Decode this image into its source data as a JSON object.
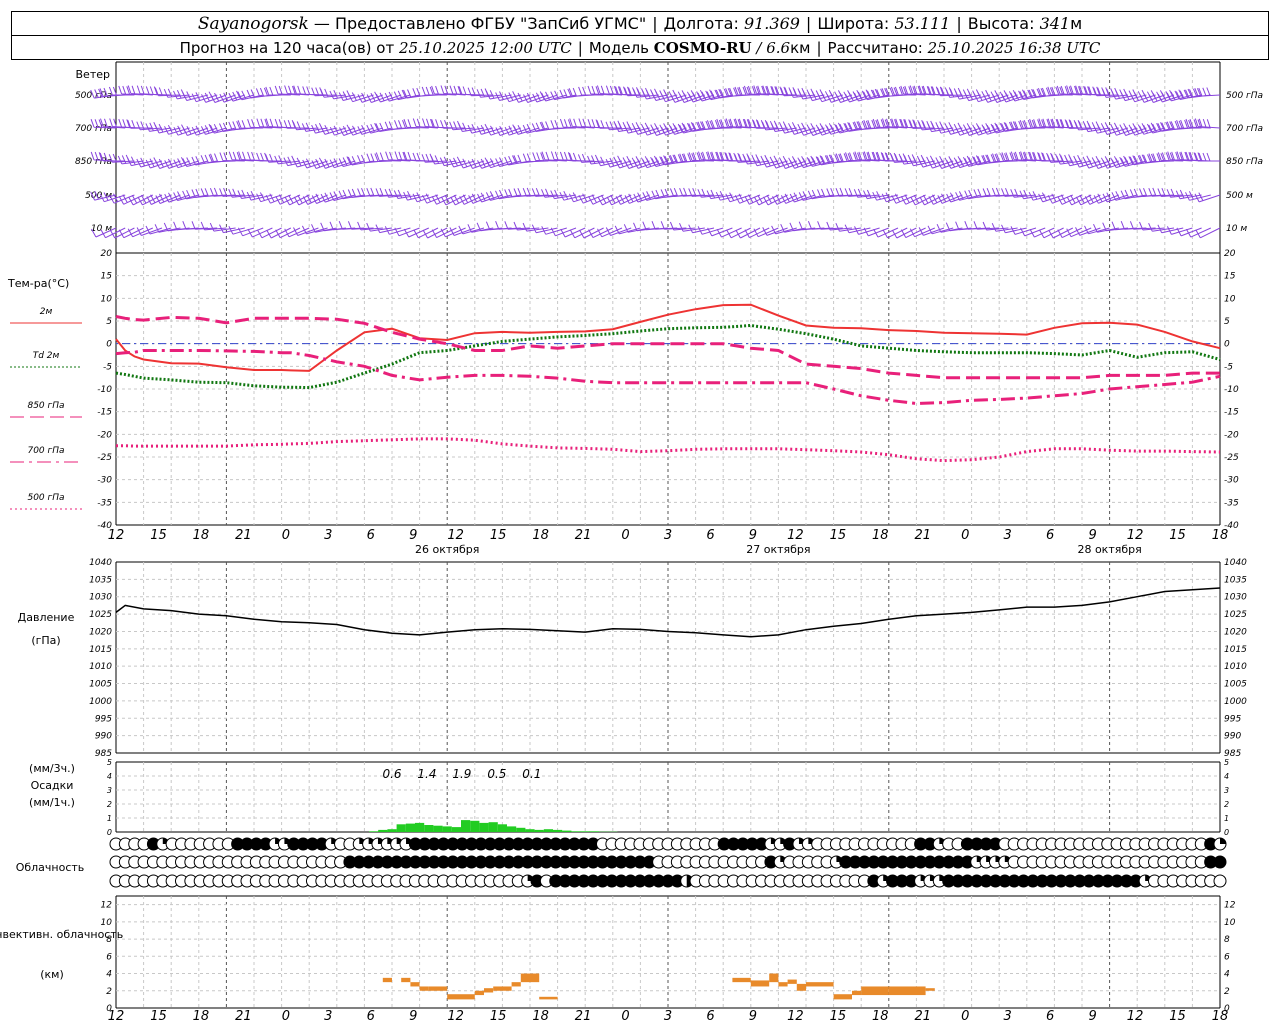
{
  "header": {
    "station": "Sayanogorsk",
    "provider": "— Предоставлено ФГБУ \"ЗапСиб УГМС\"",
    "lon_label": "Долгота:",
    "lon_value": "91.369",
    "lat_label": "Широта:",
    "lat_value": "53.111",
    "alt_label": "Высота:",
    "alt_value": "341",
    "alt_unit": "м",
    "forecast_label": "Прогноз на 120 часа(ов) от",
    "forecast_start": "25.10.2025 12:00 UTC",
    "model_label": "Модель",
    "model_name": "COSMO-RU",
    "model_res": "/ 6.6",
    "model_res_unit": "км",
    "calc_label": "Рассчитано:",
    "calc_time": "25.10.2025 16:38 UTC"
  },
  "colors": {
    "t2m": "#ee3333",
    "td2m": "#117711",
    "t850": "#e8207a",
    "t700": "#e8207a",
    "t500": "#e8207a",
    "wind": "#8844dd",
    "precip": "#22cc22",
    "conv": "#e88a2a",
    "pressure": "#000000"
  },
  "chart_data": [
    {
      "type": "wind-barbs",
      "title": "Ветер",
      "levels": [
        "500 гПа",
        "700 гПа",
        "850 гПа",
        "500 м",
        "10 м"
      ],
      "note": "wind barbs at 5 levels, hourly, mostly westerly/north-westerly flow"
    },
    {
      "type": "line",
      "title": "Тем-ра(°С)",
      "ylim": [
        -40,
        20
      ],
      "yticks": [
        20,
        15,
        10,
        5,
        0,
        -5,
        -10,
        -15,
        -20,
        -25,
        -30,
        -35,
        -40
      ],
      "x_hours_from_start": [
        0,
        1,
        2,
        3,
        6,
        9,
        12,
        15,
        18,
        19,
        21,
        24,
        27,
        30,
        33,
        36,
        39,
        42,
        45,
        48,
        51,
        54,
        57,
        60,
        63,
        66,
        69,
        72,
        75,
        78,
        81,
        84,
        87,
        90,
        93,
        96,
        99,
        102,
        105,
        108,
        111,
        114,
        117,
        120
      ],
      "series": [
        {
          "name": "2м",
          "style": "solid",
          "values": [
            1,
            -1.5,
            -2.8,
            -3.5,
            -4.3,
            -4.4,
            -5.2,
            -5.8,
            -5.8,
            -5.9,
            -6,
            -1.5,
            2.5,
            3.3,
            1.2,
            0.8,
            2.3,
            2.6,
            2.4,
            2.6,
            2.7,
            3.2,
            4.8,
            6.4,
            7.6,
            8.5,
            8.6,
            6.2,
            4,
            3.5,
            3.4,
            3,
            2.8,
            2.4,
            2.3,
            2.2,
            2,
            3.5,
            4.5,
            4.6,
            4.2,
            2.6,
            0.5,
            -1
          ]
        },
        {
          "name": "Td 2м",
          "style": "dotted",
          "values": [
            -6.5,
            -6.8,
            -7.2,
            -7.6,
            -8,
            -8.5,
            -8.6,
            -9.3,
            -9.6,
            -9.6,
            -9.7,
            -8.5,
            -6.5,
            -4.5,
            -2,
            -1.5,
            -0.5,
            0.5,
            1,
            1.5,
            1.8,
            2.2,
            2.8,
            3.3,
            3.5,
            3.6,
            4,
            3.2,
            2.2,
            1,
            -0.5,
            -1,
            -1.5,
            -1.8,
            -2,
            -2,
            -2,
            -2.2,
            -2.5,
            -1.5,
            -3,
            -2,
            -1.8,
            -3.5
          ]
        },
        {
          "name": "850 гПа",
          "style": "long-dash",
          "values": [
            6,
            5.6,
            5.3,
            5.2,
            5.8,
            5.6,
            4.6,
            5.6,
            5.6,
            5.6,
            5.6,
            5.4,
            4.5,
            2.5,
            1,
            0,
            -1.5,
            -1.5,
            -0.5,
            -1,
            -0.5,
            0,
            0,
            0,
            0,
            0,
            -1,
            -1.5,
            -4.5,
            -5,
            -5.5,
            -6.5,
            -7,
            -7.5,
            -7.5,
            -7.5,
            -7.5,
            -7.5,
            -7.5,
            -7,
            -7,
            -7,
            -6.5,
            -6.5
          ]
        },
        {
          "name": "700 гПа",
          "style": "dash-dot",
          "values": [
            -2.2,
            -2,
            -1.9,
            -1.5,
            -1.5,
            -1.5,
            -1.6,
            -1.7,
            -2,
            -2,
            -2.6,
            -4,
            -5,
            -7,
            -8,
            -7.4,
            -7,
            -7,
            -7.2,
            -7.6,
            -8.3,
            -8.6,
            -8.6,
            -8.6,
            -8.6,
            -8.6,
            -8.6,
            -8.6,
            -8.6,
            -10,
            -11.5,
            -12.5,
            -13.2,
            -13,
            -12.5,
            -12.3,
            -12,
            -11.5,
            -11,
            -10,
            -9.5,
            -9,
            -8.5,
            -7.2
          ]
        },
        {
          "name": "500 гПа",
          "style": "fine-dot",
          "values": [
            -22.5,
            -22.5,
            -22.6,
            -22.6,
            -22.6,
            -22.6,
            -22.6,
            -22.3,
            -22.2,
            -22.1,
            -22,
            -21.6,
            -21.4,
            -21.2,
            -21,
            -21,
            -21.3,
            -22.1,
            -22.6,
            -23,
            -23.1,
            -23.3,
            -23.8,
            -23.6,
            -23.3,
            -23.2,
            -23.2,
            -23.2,
            -23.4,
            -23.6,
            -23.9,
            -24.5,
            -25.4,
            -25.8,
            -25.6,
            -25,
            -23.8,
            -23.2,
            -23.2,
            -23.5,
            -23.7,
            -23.7,
            -23.8,
            -23.9
          ]
        }
      ],
      "x_tick_labels": [
        "12",
        "15",
        "18",
        "21",
        "0",
        "3",
        "6",
        "9",
        "12",
        "15",
        "18",
        "21",
        "0",
        "3",
        "6",
        "9",
        "12",
        "15",
        "18",
        "21",
        "0",
        "3",
        "6",
        "9",
        "12",
        "15",
        "18"
      ],
      "day_labels": [
        "26 октября",
        "27 октября",
        "28 октября"
      ]
    },
    {
      "type": "line",
      "title": "Давление",
      "ylabel": "(гПа)",
      "ylim": [
        985,
        1040
      ],
      "yticks": [
        1040,
        1035,
        1030,
        1025,
        1020,
        1015,
        1010,
        1005,
        1000,
        995,
        990,
        985
      ],
      "x_hours_from_start": [
        0,
        1,
        3,
        6,
        9,
        12,
        15,
        18,
        21,
        24,
        27,
        30,
        33,
        36,
        39,
        42,
        45,
        48,
        51,
        54,
        57,
        60,
        63,
        66,
        69,
        72,
        75,
        78,
        81,
        84,
        87,
        90,
        93,
        96,
        99,
        102,
        105,
        108,
        111,
        114,
        117,
        120
      ],
      "series": [
        {
          "name": "Давление",
          "values": [
            1025.5,
            1027.5,
            1026.5,
            1026,
            1025,
            1024.5,
            1023.5,
            1022.8,
            1022.5,
            1022,
            1020.5,
            1019.5,
            1019,
            1019.8,
            1020.5,
            1020.8,
            1020.6,
            1020.2,
            1019.8,
            1020.8,
            1020.6,
            1020,
            1019.6,
            1019,
            1018.5,
            1019,
            1020.5,
            1021.5,
            1022.3,
            1023.5,
            1024.5,
            1025,
            1025.5,
            1026.2,
            1027,
            1027,
            1027.5,
            1028.5,
            1030,
            1031.5,
            1032,
            1032.5
          ]
        }
      ]
    },
    {
      "type": "bar",
      "title": "Осадки",
      "ylabel_3h": "(мм/3ч.)",
      "ylabel_1h": "(мм/1ч.)",
      "ylim": [
        0,
        5
      ],
      "yticks": [
        5,
        4,
        3,
        2,
        1,
        0
      ],
      "sum_labels": [
        "0.6",
        "1.4",
        "1.9",
        "0.5",
        "0.1"
      ],
      "x_hours_from_start": [
        28,
        29,
        30,
        31,
        32,
        33,
        34,
        35,
        36,
        37,
        38,
        39,
        40,
        41,
        42,
        43,
        44,
        45,
        46,
        47,
        48,
        49,
        50,
        51,
        52,
        53,
        54
      ],
      "values": [
        0.05,
        0.15,
        0.2,
        0.55,
        0.6,
        0.65,
        0.5,
        0.45,
        0.4,
        0.35,
        0.85,
        0.8,
        0.65,
        0.7,
        0.55,
        0.4,
        0.3,
        0.2,
        0.15,
        0.2,
        0.15,
        0.1,
        0.05,
        0.05,
        0.05,
        0.02,
        0.02
      ]
    },
    {
      "type": "cloud-circles",
      "title": "Облачность",
      "rows": [
        "00006300000006666336666300333333666666666666666666660000000000000666663363300000000000663006666000000000000000000000063",
        "00000000000000000000000006666666666666666666666666666666660000000000006300000366666666666666333300000000000000000000066",
        "00000000000000000000000000000000000000000000360666666666666665000000000000000000063666333666666666666666666666300000000"
      ],
      "legend": "0 clear, 3 quarter, 5 half, 6 overcast (dark)"
    },
    {
      "type": "bar-range",
      "title": "Конвективн. облачность",
      "ylabel": "(км)",
      "ylim": [
        0,
        13
      ],
      "yticks": [
        12,
        10,
        8,
        6,
        4,
        2,
        0
      ],
      "segments": [
        {
          "start": 29,
          "end": 30,
          "bottom": 3.0,
          "top": 3.5
        },
        {
          "start": 31,
          "end": 32,
          "bottom": 3.0,
          "top": 3.5
        },
        {
          "start": 32,
          "end": 33,
          "bottom": 2.5,
          "top": 3.0
        },
        {
          "start": 33,
          "end": 34,
          "bottom": 2.0,
          "top": 2.5
        },
        {
          "start": 34,
          "end": 35,
          "bottom": 2.0,
          "top": 2.5
        },
        {
          "start": 35,
          "end": 36,
          "bottom": 2.0,
          "top": 2.5
        },
        {
          "start": 36,
          "end": 39,
          "bottom": 1.0,
          "top": 1.6
        },
        {
          "start": 39,
          "end": 40,
          "bottom": 1.5,
          "top": 2.0
        },
        {
          "start": 40,
          "end": 41,
          "bottom": 1.8,
          "top": 2.3
        },
        {
          "start": 41,
          "end": 43,
          "bottom": 2.0,
          "top": 2.5
        },
        {
          "start": 43,
          "end": 44,
          "bottom": 2.5,
          "top": 3.0
        },
        {
          "start": 44,
          "end": 46,
          "bottom": 3.0,
          "top": 4.0
        },
        {
          "start": 46,
          "end": 48,
          "bottom": 1.0,
          "top": 1.3
        },
        {
          "start": 67,
          "end": 69,
          "bottom": 3.0,
          "top": 3.5
        },
        {
          "start": 69,
          "end": 71,
          "bottom": 2.5,
          "top": 3.2
        },
        {
          "start": 71,
          "end": 72,
          "bottom": 3.0,
          "top": 4.0
        },
        {
          "start": 72,
          "end": 73,
          "bottom": 2.5,
          "top": 3.0
        },
        {
          "start": 73,
          "end": 74,
          "bottom": 2.8,
          "top": 3.3
        },
        {
          "start": 74,
          "end": 75,
          "bottom": 2.0,
          "top": 2.8
        },
        {
          "start": 75,
          "end": 78,
          "bottom": 2.5,
          "top": 3.0
        },
        {
          "start": 78,
          "end": 80,
          "bottom": 1.0,
          "top": 1.6
        },
        {
          "start": 80,
          "end": 81,
          "bottom": 1.5,
          "top": 2.0
        },
        {
          "start": 81,
          "end": 84,
          "bottom": 1.5,
          "top": 2.5
        },
        {
          "start": 84,
          "end": 88,
          "bottom": 1.5,
          "top": 2.5
        },
        {
          "start": 88,
          "end": 89,
          "bottom": 2.0,
          "top": 2.3
        }
      ]
    }
  ]
}
